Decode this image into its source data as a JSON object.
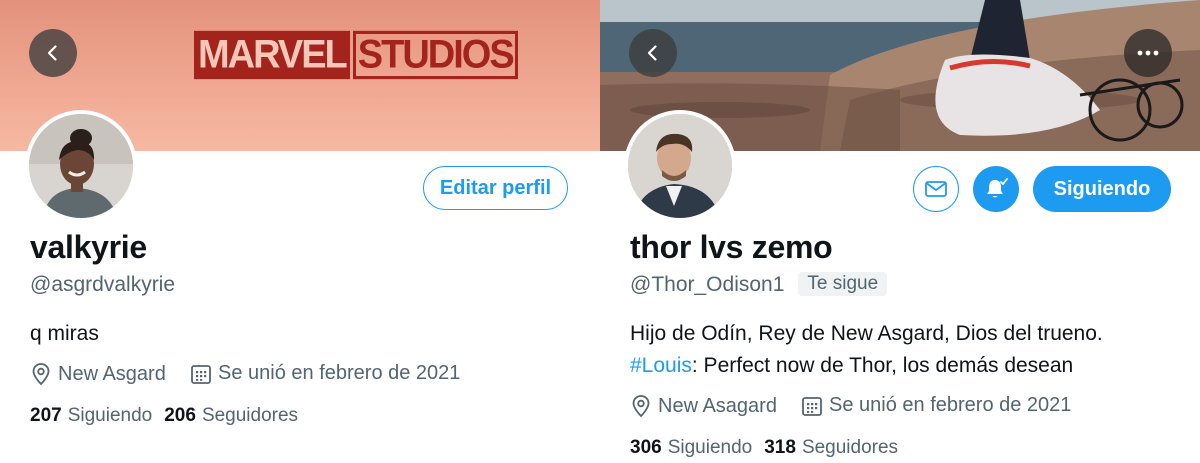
{
  "left_profile": {
    "banner_logo": {
      "part1": "MARVEL",
      "part2": "STUDIOS"
    },
    "back_icon": "chevron-left-icon",
    "edit_button": "Editar perfil",
    "name": "valkyrie",
    "handle": "@asgrdvalkyrie",
    "bio": "q miras",
    "location": "New Asgard",
    "joined": "Se unió en febrero de 2021",
    "following_count": "207",
    "following_label": "Siguiendo",
    "followers_count": "206",
    "followers_label": "Seguidores"
  },
  "right_profile": {
    "back_icon": "chevron-left-icon",
    "more_icon": "more-horizontal-icon",
    "message_icon": "mail-icon",
    "notify_icon": "bell-check-icon",
    "follow_button": "Siguiendo",
    "name": "thor lvs zemo",
    "handle": "@Thor_Odison1",
    "follows_you_badge": "Te sigue",
    "bio_line1": "Hijo de Odín, Rey de New Asgard, Dios del trueno.",
    "bio_hashtag": "#Louis",
    "bio_line2_rest": ": Perfect now de Thor, los demás desean",
    "location": "New Asagard",
    "joined": "Se unió en febrero de 2021",
    "following_count": "306",
    "following_label": "Siguiendo",
    "followers_count": "318",
    "followers_label": "Seguidores"
  },
  "colors": {
    "accent": "#1d9bf0",
    "left_banner": "#f0a993",
    "marvel_red": "#a3241c",
    "text_primary": "#0f1419",
    "text_secondary": "#536471"
  }
}
